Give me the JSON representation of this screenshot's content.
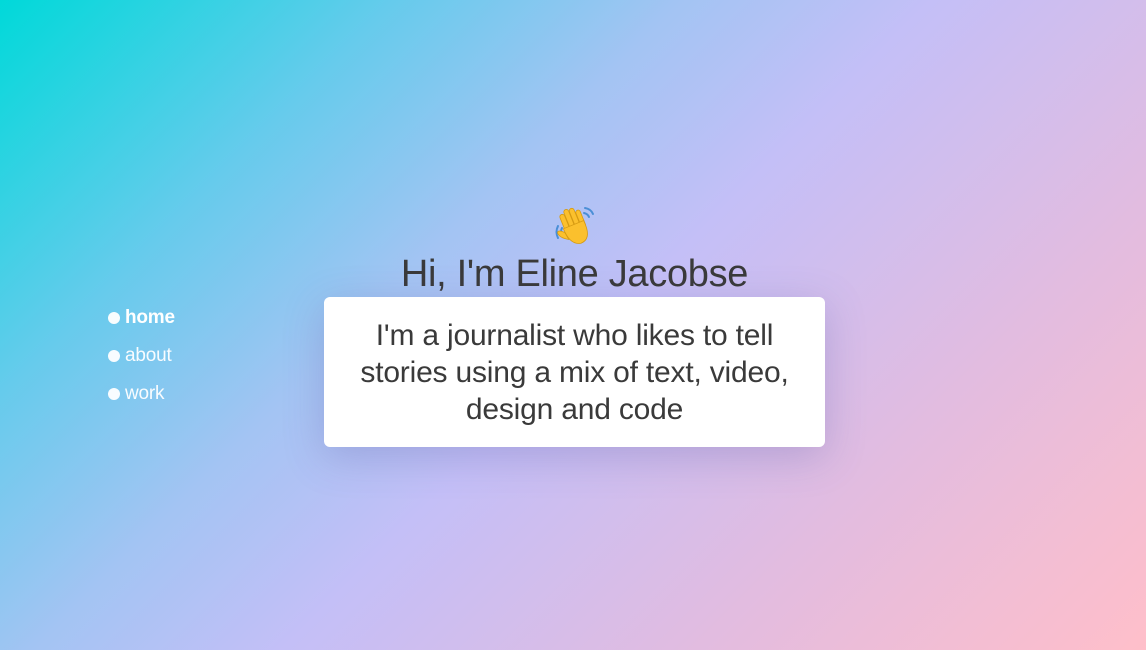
{
  "nav": {
    "items": [
      {
        "label": "home",
        "active": true
      },
      {
        "label": "about",
        "active": false
      },
      {
        "label": "work",
        "active": false
      }
    ]
  },
  "hero": {
    "icon": "waving-hand-icon",
    "title": "Hi, I'm Eline Jacobse",
    "intro": "I'm a journalist who likes to tell stories using a mix of text, video, design and code"
  },
  "colors": {
    "gradient_start": "#00d9d9",
    "gradient_mid": "#c4bff7",
    "gradient_end": "#ffbfca",
    "text": "#3a3a3a",
    "card": "#ffffff"
  }
}
